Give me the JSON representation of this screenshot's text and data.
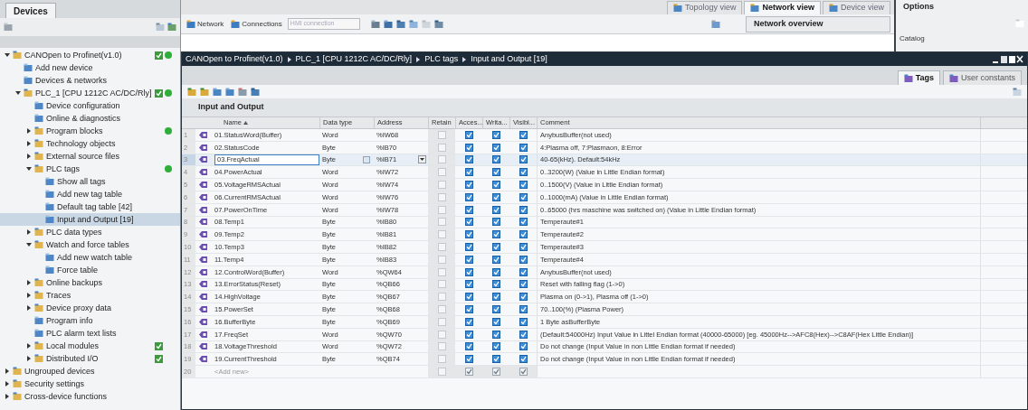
{
  "devices_panel": {
    "title": "Devices",
    "tree": [
      {
        "label": "CANOpen to Profinet(v1.0)",
        "selected": false,
        "expanded": true,
        "check": true,
        "dot": true,
        "children": [
          {
            "label": "Add new device",
            "selected": false
          },
          {
            "label": "Devices & networks",
            "selected": false
          },
          {
            "label": "PLC_1 [CPU 1212C AC/DC/Rly]",
            "selected": false,
            "expanded": true,
            "check": true,
            "dot": true,
            "children": [
              {
                "label": "Device configuration",
                "selected": false
              },
              {
                "label": "Online & diagnostics",
                "selected": false
              },
              {
                "label": "Program blocks",
                "selected": false,
                "expanded": false,
                "dot": true
              },
              {
                "label": "Technology objects",
                "selected": false,
                "expanded": false
              },
              {
                "label": "External source files",
                "selected": false,
                "expanded": false
              },
              {
                "label": "PLC tags",
                "selected": false,
                "expanded": true,
                "dot": true,
                "children": [
                  {
                    "label": "Show all tags",
                    "selected": false
                  },
                  {
                    "label": "Add new tag table",
                    "selected": false
                  },
                  {
                    "label": "Default tag table [42]",
                    "selected": false
                  },
                  {
                    "label": "Input and Output [19]",
                    "selected": true
                  }
                ]
              },
              {
                "label": "PLC data types",
                "selected": false,
                "expanded": false
              },
              {
                "label": "Watch and force tables",
                "selected": false,
                "expanded": true,
                "children": [
                  {
                    "label": "Add new watch table",
                    "selected": false
                  },
                  {
                    "label": "Force table",
                    "selected": false
                  }
                ]
              },
              {
                "label": "Online backups",
                "selected": false,
                "expanded": false
              },
              {
                "label": "Traces",
                "selected": false,
                "expanded": false
              },
              {
                "label": "Device proxy data",
                "selected": false,
                "expanded": false
              },
              {
                "label": "Program info",
                "selected": false
              },
              {
                "label": "PLC alarm text lists",
                "selected": false
              },
              {
                "label": "Local modules",
                "selected": false,
                "expanded": false,
                "check": true
              },
              {
                "label": "Distributed I/O",
                "selected": false,
                "expanded": false,
                "check": true
              }
            ]
          }
        ]
      },
      {
        "label": "Ungrouped devices",
        "selected": false,
        "expanded": false
      },
      {
        "label": "Security settings",
        "selected": false,
        "expanded": false
      },
      {
        "label": "Cross-device functions",
        "selected": false,
        "expanded": false
      }
    ]
  },
  "toolbar": {
    "items": [
      "Network",
      "Connections"
    ],
    "connection_dropdown": {
      "placeholder": "HMI connection"
    }
  },
  "view_tabs": [
    {
      "label": "Topology view",
      "selected": false
    },
    {
      "label": "Network view",
      "selected": true
    },
    {
      "label": "Device view",
      "selected": false
    }
  ],
  "network_overview_tab": "Network overview",
  "options_panel": {
    "title": "Options",
    "section": "Catalog"
  },
  "editor": {
    "breadcrumb": [
      "CANOpen to Profinet(v1.0)",
      "PLC_1 [CPU 1212C AC/DC/Rly]",
      "PLC tags",
      "Input and Output [19]"
    ],
    "tabs": [
      {
        "label": "Tags",
        "selected": true
      },
      {
        "label": "User constants",
        "selected": false
      }
    ],
    "table_title": "Input and Output",
    "columns": [
      "Name",
      "Data type",
      "Address",
      "Retain",
      "Acces...",
      "Writa...",
      "Visibl...",
      "Comment"
    ],
    "rows": [
      {
        "number": "1",
        "name": "01.StatusWord(Buffer)",
        "data_type": "Word",
        "address": "%IW68",
        "retain": false,
        "accessible": true,
        "writable": true,
        "visible": true,
        "comment": "AnybusBuffer(not used)",
        "selected": false
      },
      {
        "number": "2",
        "name": "02.StatusCode",
        "data_type": "Byte",
        "address": "%IB70",
        "retain": false,
        "accessible": true,
        "writable": true,
        "visible": true,
        "comment": "4:Plasma off, 7:Plasmaon, 8:Error",
        "selected": false
      },
      {
        "number": "3",
        "name": "03.FreqActual",
        "data_type": "Byte",
        "address": "%IB71",
        "retain": false,
        "accessible": true,
        "writable": true,
        "visible": true,
        "comment": "40-65(kHz). Default:54kHz",
        "selected": true
      },
      {
        "number": "4",
        "name": "04.PowerActual",
        "data_type": "Word",
        "address": "%IW72",
        "retain": false,
        "accessible": true,
        "writable": true,
        "visible": true,
        "comment": "0..3200(W) (Value in Little Endian format)",
        "selected": false
      },
      {
        "number": "5",
        "name": "05.VoltageRMSActual",
        "data_type": "Word",
        "address": "%IW74",
        "retain": false,
        "accessible": true,
        "writable": true,
        "visible": true,
        "comment": "0..1500(V) (Value in Little Endian format)",
        "selected": false
      },
      {
        "number": "6",
        "name": "06.CurrentRMSActual",
        "data_type": "Word",
        "address": "%IW76",
        "retain": false,
        "accessible": true,
        "writable": true,
        "visible": true,
        "comment": "0..1000(mA) (Value in Little Endian format)",
        "selected": false
      },
      {
        "number": "7",
        "name": "07.PowerOnTime",
        "data_type": "Word",
        "address": "%IW78",
        "retain": false,
        "accessible": true,
        "writable": true,
        "visible": true,
        "comment": "0..65000 (hrs maschine was switched on) (Value in Little Endian format)",
        "selected": false
      },
      {
        "number": "8",
        "name": "08.Temp1",
        "data_type": "Byte",
        "address": "%IB80",
        "retain": false,
        "accessible": true,
        "writable": true,
        "visible": true,
        "comment": "Temperaute#1",
        "selected": false
      },
      {
        "number": "9",
        "name": "09.Temp2",
        "data_type": "Byte",
        "address": "%IB81",
        "retain": false,
        "accessible": true,
        "writable": true,
        "visible": true,
        "comment": "Temperaute#2",
        "selected": false
      },
      {
        "number": "10",
        "name": "10.Temp3",
        "data_type": "Byte",
        "address": "%IB82",
        "retain": false,
        "accessible": true,
        "writable": true,
        "visible": true,
        "comment": "Temperaute#3",
        "selected": false
      },
      {
        "number": "11",
        "name": "11.Temp4",
        "data_type": "Byte",
        "address": "%IB83",
        "retain": false,
        "accessible": true,
        "writable": true,
        "visible": true,
        "comment": "Temperaute#4",
        "selected": false
      },
      {
        "number": "12",
        "name": "12.ControlWord(Buffer)",
        "data_type": "Word",
        "address": "%QW64",
        "retain": false,
        "accessible": true,
        "writable": true,
        "visible": true,
        "comment": "AnybusBuffer(not used)",
        "selected": false
      },
      {
        "number": "13",
        "name": "13.ErrorStatus(Reset)",
        "data_type": "Byte",
        "address": "%QB66",
        "retain": false,
        "accessible": true,
        "writable": true,
        "visible": true,
        "comment": "Reset with falling flag (1->0)",
        "selected": false
      },
      {
        "number": "14",
        "name": "14.HighVoltage",
        "data_type": "Byte",
        "address": "%QB67",
        "retain": false,
        "accessible": true,
        "writable": true,
        "visible": true,
        "comment": "Plasma on (0->1), Plasma off (1->0)",
        "selected": false
      },
      {
        "number": "15",
        "name": "15.PowerSet",
        "data_type": "Byte",
        "address": "%QB68",
        "retain": false,
        "accessible": true,
        "writable": true,
        "visible": true,
        "comment": "70..100(%) (Plasma Power)",
        "selected": false
      },
      {
        "number": "16",
        "name": "16.BufferByte",
        "data_type": "Byte",
        "address": "%QB69",
        "retain": false,
        "accessible": true,
        "writable": true,
        "visible": true,
        "comment": "1 Byte asBufferByte",
        "selected": false
      },
      {
        "number": "17",
        "name": "17.FreqSet",
        "data_type": "Word",
        "address": "%QW70",
        "retain": false,
        "accessible": true,
        "writable": true,
        "visible": true,
        "comment": "(Default:54000Hz) Input Value in Littel Endian format (40000-65000) [eg. 45000Hz-->AFC8(Hex)-->C8AF(Hex Little Endian)]",
        "selected": false
      },
      {
        "number": "18",
        "name": "18.VoltageThreshold",
        "data_type": "Word",
        "address": "%QW72",
        "retain": false,
        "accessible": true,
        "writable": true,
        "visible": true,
        "comment": "Do not change (Input Value in non Little Endian format if needed)",
        "selected": false
      },
      {
        "number": "19",
        "name": "19.CurrentThreshold",
        "data_type": "Byte",
        "address": "%QB74",
        "retain": false,
        "accessible": true,
        "writable": true,
        "visible": true,
        "comment": "Do not change (Input Value in non Little Endian format if needed)",
        "selected": false
      }
    ],
    "add_row": {
      "number": "20",
      "label": "<Add new>",
      "retain": false,
      "accessible": true,
      "writable": true,
      "visible": true
    }
  }
}
